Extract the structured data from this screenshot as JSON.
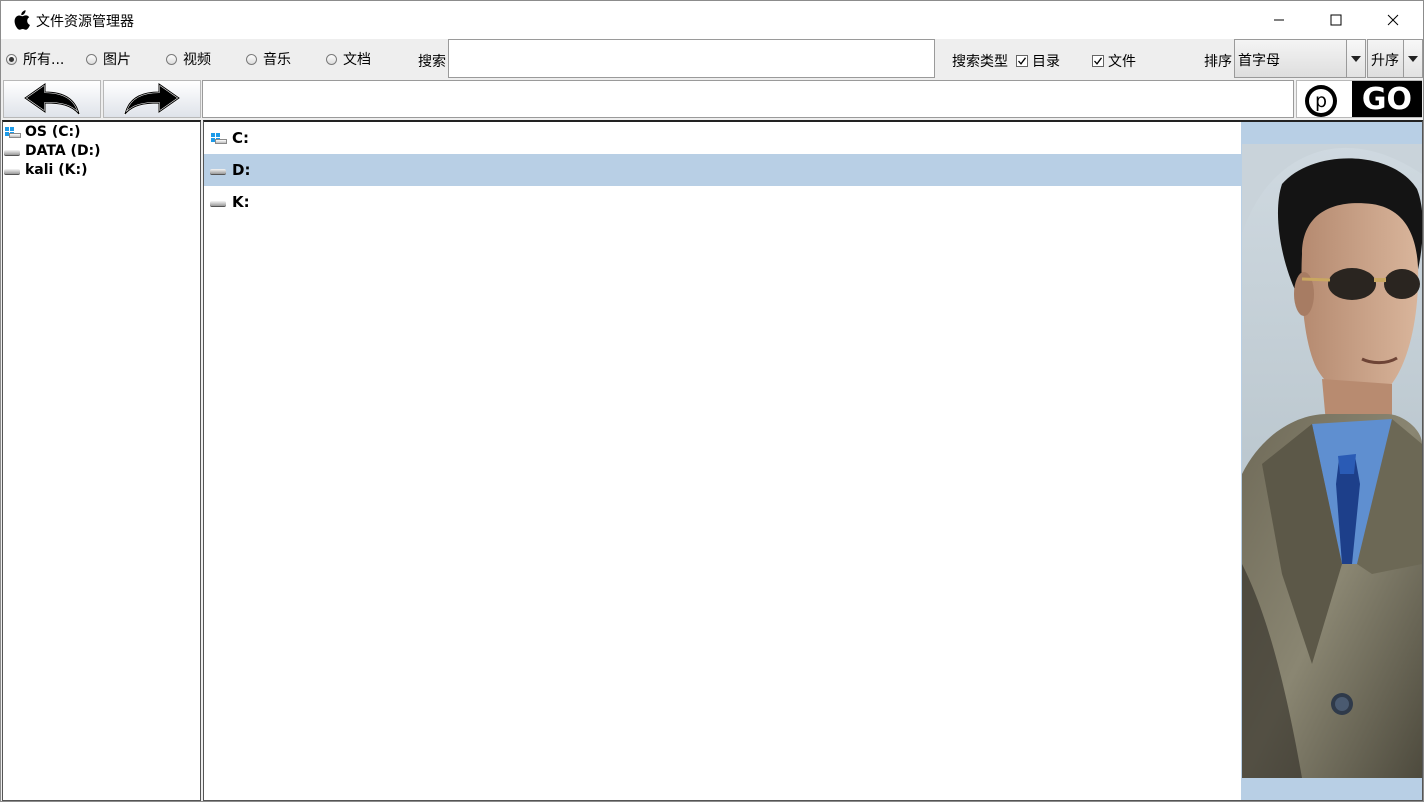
{
  "window": {
    "title": "文件资源管理器",
    "app_icon": "apple-icon"
  },
  "toolbar": {
    "filters": [
      {
        "label": "所有...",
        "selected": true
      },
      {
        "label": "图片",
        "selected": false
      },
      {
        "label": "视频",
        "selected": false
      },
      {
        "label": "音乐",
        "selected": false
      },
      {
        "label": "文档",
        "selected": false
      }
    ],
    "search_label": "搜索",
    "search_value": "",
    "search_type_label": "搜索类型",
    "type_checks": [
      {
        "label": "目录",
        "checked": true
      },
      {
        "label": "文件",
        "checked": true
      }
    ],
    "sort_label": "排序",
    "sort_value": "首字母",
    "order_value": "升序"
  },
  "navbar": {
    "back_icon": "arrow-back-icon",
    "forward_icon": "arrow-forward-icon",
    "path_value": "",
    "go_p": "p",
    "go_label": "GO"
  },
  "tree": {
    "items": [
      {
        "label": "OS (C:)",
        "icon": "windows-drive-icon"
      },
      {
        "label": "DATA (D:)",
        "icon": "drive-icon"
      },
      {
        "label": "kali (K:)",
        "icon": "drive-icon"
      }
    ]
  },
  "list": {
    "rows": [
      {
        "label": "C:",
        "icon": "windows-drive-icon",
        "selected": false
      },
      {
        "label": "D:",
        "icon": "drive-icon",
        "selected": true
      },
      {
        "label": "K:",
        "icon": "drive-icon",
        "selected": false
      }
    ]
  },
  "colors": {
    "selection": "#b8cfe5",
    "windows_blue": "#1e9be8"
  }
}
